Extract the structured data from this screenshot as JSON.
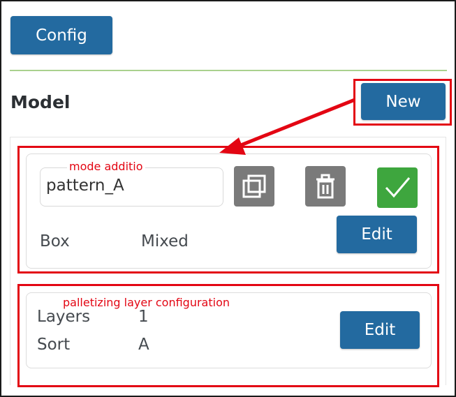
{
  "toolbar": {
    "config_label": "Config"
  },
  "model_section": {
    "title": "Model",
    "new_label": "New"
  },
  "model_card": {
    "annotation": "mode additio",
    "name_value": "pattern_A",
    "box_label": "Box",
    "box_type": "Mixed",
    "edit_label": "Edit",
    "icons": [
      "copy-icon",
      "trash-icon",
      "check-icon"
    ]
  },
  "layer_card": {
    "annotation": "palletizing layer configuration",
    "layers_label": "Layers",
    "layers_value": "1",
    "sort_label": "Sort",
    "sort_value": "A",
    "edit_label": "Edit"
  },
  "colors": {
    "primary": "#236aa0",
    "highlight": "#e30613",
    "confirm": "#3ea63e",
    "icon_button": "#7a7a7a",
    "divider": "#a9d18e"
  }
}
